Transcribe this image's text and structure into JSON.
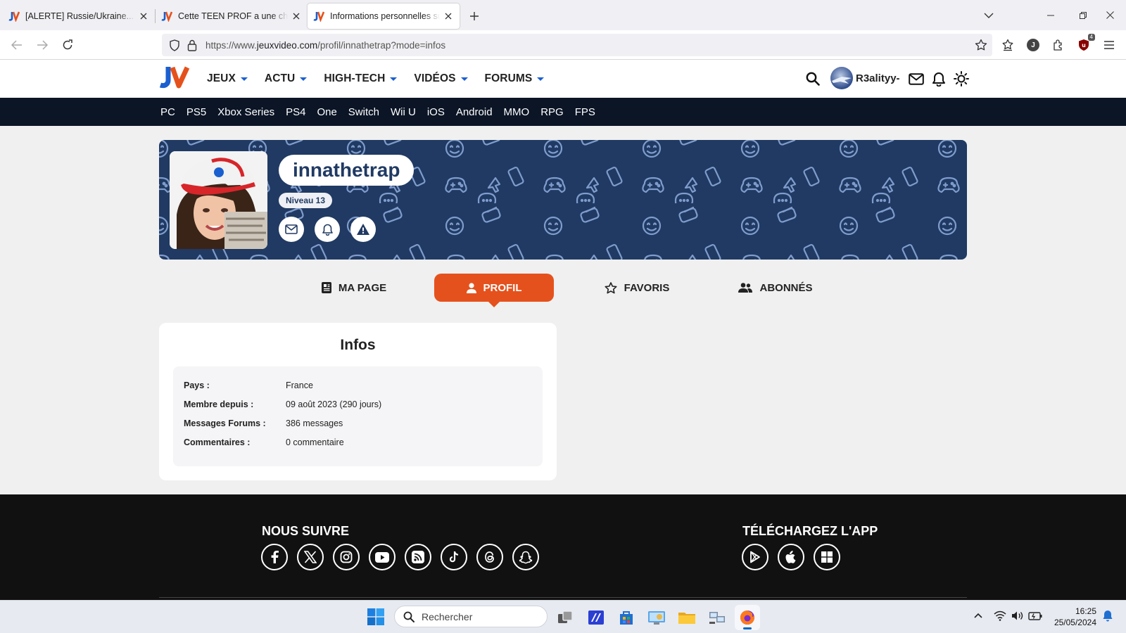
{
  "browser": {
    "tabs": [
      {
        "title": "[ALERTE] Russie/Ukraine... Suite à",
        "active": false
      },
      {
        "title": "Cette TEEN PROF a une chaîne you",
        "active": false
      },
      {
        "title": "Informations personnelles sur le",
        "active": true
      }
    ],
    "url_prefix": "https://www.",
    "url_domain": "jeuxvideo.com",
    "url_path": "/profil/innathetrap?mode=infos",
    "extension_badge": "4",
    "account_letter": "J"
  },
  "site": {
    "menu": [
      {
        "label": "JEUX"
      },
      {
        "label": "ACTU"
      },
      {
        "label": "HIGH-TECH"
      },
      {
        "label": "VIDÉOS"
      },
      {
        "label": "FORUMS"
      }
    ],
    "user": "R3alityy-",
    "platforms": [
      "PC",
      "PS5",
      "Xbox Series",
      "PS4",
      "One",
      "Switch",
      "Wii U",
      "iOS",
      "Android",
      "MMO",
      "RPG",
      "FPS"
    ],
    "accent": "#e5511c",
    "banner_color": "#203a63"
  },
  "profile": {
    "username": "innathetrap",
    "level": "Niveau 13",
    "tabs": [
      {
        "label": "MA PAGE",
        "active": false
      },
      {
        "label": "PROFIL",
        "active": true
      },
      {
        "label": "FAVORIS",
        "active": false
      },
      {
        "label": "ABONNÉS",
        "active": false
      }
    ],
    "infos_title": "Infos",
    "infos": [
      {
        "key": "Pays :",
        "value": "France"
      },
      {
        "key": "Membre depuis :",
        "value": "09 août 2023 (290 jours)"
      },
      {
        "key": "Messages Forums :",
        "value": "386 messages"
      },
      {
        "key": "Commentaires :",
        "value": "0 commentaire"
      }
    ]
  },
  "footer": {
    "follow_title": "NOUS SUIVRE",
    "app_title": "TÉLÉCHARGEZ L'APP",
    "socials": [
      "facebook-icon",
      "x-icon",
      "instagram-icon",
      "youtube-icon",
      "rss-icon",
      "tiktok-icon",
      "threads-icon",
      "snapchat-icon"
    ],
    "apps": [
      "google-play-icon",
      "apple-icon",
      "windows-icon"
    ]
  },
  "taskbar": {
    "search_placeholder": "Rechercher",
    "time": "16:25",
    "date": "25/05/2024"
  }
}
